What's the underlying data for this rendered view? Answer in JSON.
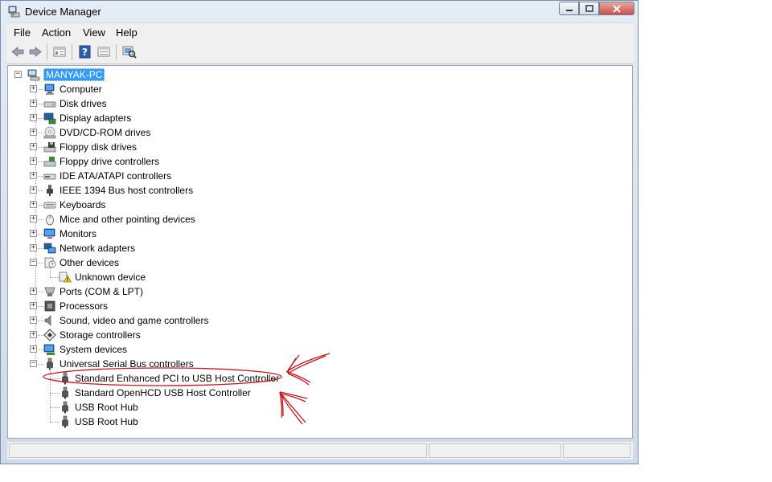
{
  "window": {
    "title": "Device Manager"
  },
  "menu": [
    "File",
    "Action",
    "View",
    "Help"
  ],
  "toolbar": {
    "icons": [
      "back-arrow-icon",
      "forward-arrow-icon",
      "properties-icon",
      "help-icon",
      "view-icon",
      "scan-hardware-icon"
    ]
  },
  "tree": {
    "root": "MANYAK-PC",
    "categories": [
      {
        "label": "Computer",
        "icon": "computer-icon",
        "expanded": false
      },
      {
        "label": "Disk drives",
        "icon": "disk-drive-icon",
        "expanded": false
      },
      {
        "label": "Display adapters",
        "icon": "display-adapter-icon",
        "expanded": false
      },
      {
        "label": "DVD/CD-ROM drives",
        "icon": "dvd-drive-icon",
        "expanded": false
      },
      {
        "label": "Floppy disk drives",
        "icon": "floppy-drive-icon",
        "expanded": false
      },
      {
        "label": "Floppy drive controllers",
        "icon": "floppy-controller-icon",
        "expanded": false
      },
      {
        "label": "IDE ATA/ATAPI controllers",
        "icon": "ide-controller-icon",
        "expanded": false
      },
      {
        "label": "IEEE 1394 Bus host controllers",
        "icon": "ieee1394-icon",
        "expanded": false
      },
      {
        "label": "Keyboards",
        "icon": "keyboard-icon",
        "expanded": false
      },
      {
        "label": "Mice and other pointing devices",
        "icon": "mouse-icon",
        "expanded": false
      },
      {
        "label": "Monitors",
        "icon": "monitor-icon",
        "expanded": false
      },
      {
        "label": "Network adapters",
        "icon": "network-adapter-icon",
        "expanded": false
      },
      {
        "label": "Other devices",
        "icon": "other-devices-icon",
        "expanded": true,
        "children": [
          {
            "label": "Unknown device",
            "icon": "warning-device-icon"
          }
        ]
      },
      {
        "label": "Ports (COM & LPT)",
        "icon": "port-icon",
        "expanded": false
      },
      {
        "label": "Processors",
        "icon": "processor-icon",
        "expanded": false
      },
      {
        "label": "Sound, video and game controllers",
        "icon": "sound-icon",
        "expanded": false
      },
      {
        "label": "Storage controllers",
        "icon": "storage-controller-icon",
        "expanded": false
      },
      {
        "label": "System devices",
        "icon": "system-device-icon",
        "expanded": false
      },
      {
        "label": "Universal Serial Bus controllers",
        "icon": "usb-icon",
        "expanded": true,
        "children": [
          {
            "label": "Standard Enhanced PCI to USB Host Controller",
            "icon": "usb-plug-icon",
            "highlighted": true
          },
          {
            "label": "Standard OpenHCD USB Host Controller",
            "icon": "usb-plug-icon"
          },
          {
            "label": "USB Root Hub",
            "icon": "usb-plug-icon"
          },
          {
            "label": "USB Root Hub",
            "icon": "usb-plug-icon"
          }
        ]
      }
    ]
  },
  "annotation_color": "#c4161c",
  "selection_color": "#3399ff"
}
